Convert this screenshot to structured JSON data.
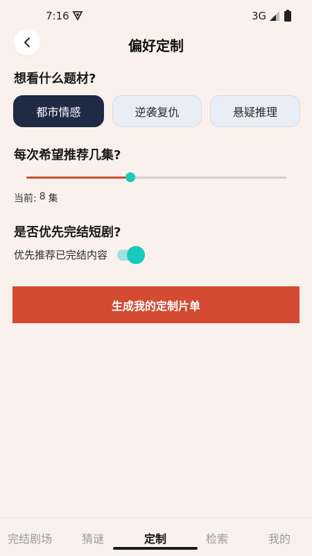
{
  "status_bar": {
    "time": "7:16",
    "network": "3G"
  },
  "header": {
    "title": "偏好定制"
  },
  "genre_section": {
    "title": "想看什么题材?",
    "options": [
      {
        "label": "都市情感",
        "selected": true
      },
      {
        "label": "逆袭复仇",
        "selected": false
      },
      {
        "label": "悬疑推理",
        "selected": false
      }
    ]
  },
  "episodes_section": {
    "title": "每次希望推荐几集?",
    "slider_value_fraction": 0.4,
    "current_label": "当前:",
    "current_value": "8",
    "current_unit": "集"
  },
  "completed_section": {
    "title": "是否优先完结短剧?",
    "toggle_label": "优先推荐已完结内容",
    "toggle_on": true
  },
  "generate_button": {
    "label": "生成我的定制片单"
  },
  "bottom_nav": {
    "items": [
      {
        "label": "完结剧场",
        "active": false
      },
      {
        "label": "猜谜",
        "active": false
      },
      {
        "label": "定制",
        "active": true
      },
      {
        "label": "检索",
        "active": false
      },
      {
        "label": "我的",
        "active": false
      }
    ]
  },
  "colors": {
    "background": "#FAF1EC",
    "accent": "#D24B32",
    "teal": "#19C9BC",
    "navy": "#1F2A44"
  },
  "icons": {
    "back": "chevron-left-icon",
    "status_shield": "shield-icon",
    "signal": "signal-icon",
    "battery": "battery-icon"
  }
}
